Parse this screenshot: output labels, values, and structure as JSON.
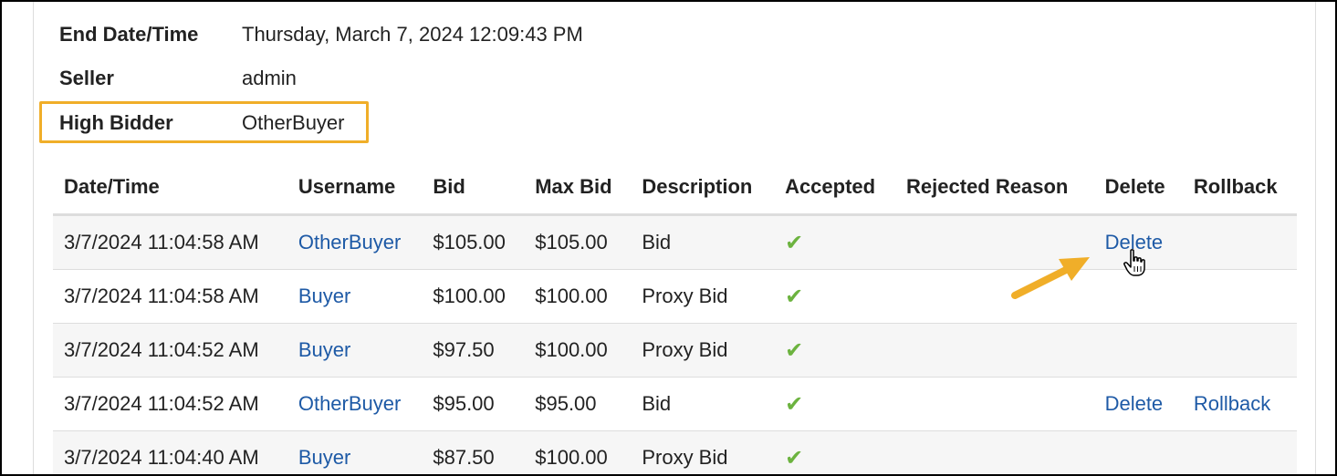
{
  "summary": {
    "end_label": "End Date/Time",
    "end_value": "Thursday, March 7, 2024 12:09:43 PM",
    "seller_label": "Seller",
    "seller_value": "admin",
    "high_bidder_label": "High Bidder",
    "high_bidder_value": "OtherBuyer"
  },
  "table": {
    "headers": [
      "Date/Time",
      "Username",
      "Bid",
      "Max Bid",
      "Description",
      "Accepted",
      "Rejected Reason",
      "Delete",
      "Rollback"
    ],
    "rows": [
      {
        "datetime": "3/7/2024 11:04:58 AM",
        "username": "OtherBuyer",
        "bid": "$105.00",
        "max_bid": "$105.00",
        "description": "Bid",
        "accepted": "✔",
        "rejected_reason": "",
        "delete": "Delete",
        "rollback": ""
      },
      {
        "datetime": "3/7/2024 11:04:58 AM",
        "username": "Buyer",
        "bid": "$100.00",
        "max_bid": "$100.00",
        "description": "Proxy Bid",
        "accepted": "✔",
        "rejected_reason": "",
        "delete": "",
        "rollback": ""
      },
      {
        "datetime": "3/7/2024 11:04:52 AM",
        "username": "Buyer",
        "bid": "$97.50",
        "max_bid": "$100.00",
        "description": "Proxy Bid",
        "accepted": "✔",
        "rejected_reason": "",
        "delete": "",
        "rollback": ""
      },
      {
        "datetime": "3/7/2024 11:04:52 AM",
        "username": "OtherBuyer",
        "bid": "$95.00",
        "max_bid": "$95.00",
        "description": "Bid",
        "accepted": "✔",
        "rejected_reason": "",
        "delete": "Delete",
        "rollback": "Rollback"
      },
      {
        "datetime": "3/7/2024 11:04:40 AM",
        "username": "Buyer",
        "bid": "$87.50",
        "max_bid": "$100.00",
        "description": "Proxy Bid",
        "accepted": "✔",
        "rejected_reason": "",
        "delete": "",
        "rollback": ""
      }
    ]
  },
  "colors": {
    "link": "#1e5aa6",
    "check": "#6cb33f",
    "highlight": "#f0ae29",
    "row_stripe": "#f6f6f6",
    "border": "#dddddd"
  },
  "icons": {
    "accepted": "checkmark-icon",
    "annotation": "arrow-annotation-icon",
    "pointer": "hand-pointer-icon"
  }
}
